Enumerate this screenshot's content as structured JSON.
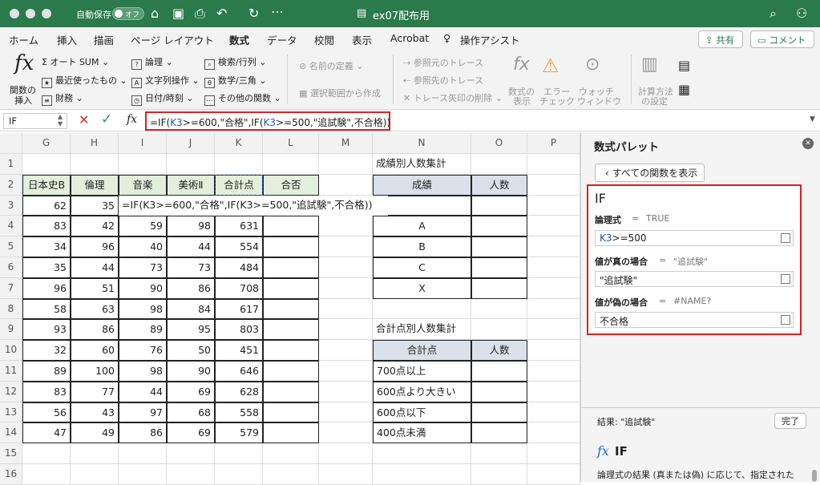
{
  "app": {
    "autosave_label": "自動保存",
    "autosave_state": "オフ",
    "title": "ex07配布用"
  },
  "ribbon_tabs": [
    "ホーム",
    "挿入",
    "描画",
    "ページ レイアウト",
    "数式",
    "データ",
    "校閲",
    "表示",
    "Acrobat",
    "操作アシスト"
  ],
  "active_tab": "数式",
  "share_label": "共有",
  "comment_label": "コメント",
  "ribbon": {
    "fx_label_1": "関数の",
    "fx_label_2": "挿入",
    "autosum": "オート SUM",
    "recent": "最近使ったもの",
    "financial": "財務",
    "logical": "論理",
    "text": "文字列操作",
    "datetime": "日付/時刻",
    "lookup": "検索/行列",
    "math": "数学/三角",
    "more": "その他の関数",
    "define_name": "名前の定義",
    "create_from_sel": "選択範囲から作成",
    "trace_precedents": "参照元のトレース",
    "trace_dependents": "参照先のトレース",
    "remove_arrows": "トレース矢印の削除",
    "show_formulas_1": "数式の",
    "show_formulas_2": "表示",
    "error_check_1": "エラー",
    "error_check_2": "チェック",
    "watch_1": "ウォッチ",
    "watch_2": "ウィンドウ",
    "calc_opt_1": "計算方法",
    "calc_opt_2": "の設定"
  },
  "formula_bar": {
    "name_box": "IF",
    "formula_pre": "=IF(",
    "ref1": "K3",
    "formula_mid": ">=600,\"合格\",IF(",
    "ref2": "K3",
    "formula_post": ">=500,\"追試験\",不合格))"
  },
  "columns": [
    "G",
    "H",
    "I",
    "J",
    "K",
    "L",
    "M",
    "N",
    "O",
    "P"
  ],
  "rows": [
    "1",
    "2",
    "3",
    "4",
    "5",
    "6",
    "7",
    "8",
    "9",
    "10",
    "11",
    "12",
    "13",
    "14",
    "15",
    "16"
  ],
  "main_table": {
    "headers": [
      "日本史B",
      "倫理",
      "音楽",
      "美術Ⅱ",
      "合計点",
      "合否"
    ],
    "rows": [
      [
        "62",
        "35",
        "",
        "",
        "",
        ""
      ],
      [
        "83",
        "42",
        "59",
        "98",
        "631",
        ""
      ],
      [
        "34",
        "96",
        "40",
        "44",
        "554",
        ""
      ],
      [
        "35",
        "44",
        "73",
        "73",
        "484",
        ""
      ],
      [
        "96",
        "51",
        "90",
        "86",
        "708",
        ""
      ],
      [
        "58",
        "63",
        "98",
        "84",
        "617",
        ""
      ],
      [
        "93",
        "86",
        "89",
        "95",
        "803",
        ""
      ],
      [
        "32",
        "60",
        "76",
        "50",
        "451",
        ""
      ],
      [
        "89",
        "100",
        "98",
        "90",
        "646",
        ""
      ],
      [
        "83",
        "77",
        "44",
        "69",
        "628",
        ""
      ],
      [
        "56",
        "43",
        "97",
        "68",
        "558",
        ""
      ],
      [
        "47",
        "49",
        "86",
        "69",
        "579",
        ""
      ]
    ],
    "editing_text": "=IF(K3>=600,\"合格\",IF(K3>=500,\"追試験\",不合格))"
  },
  "grade_table": {
    "title": "成績別人数集計",
    "headers": [
      "成績",
      "人数"
    ],
    "rows": [
      "",
      "A",
      "B",
      "C",
      "X"
    ]
  },
  "score_table": {
    "title": "合計点別人数集計",
    "headers": [
      "合計点",
      "人数"
    ],
    "rows": [
      "700点以上",
      "600点より大きい",
      "600点以下",
      "400点未満"
    ]
  },
  "palette": {
    "title": "数式パレット",
    "show_all": "すべての関数を表示",
    "func": "IF",
    "arg1_label": "論理式",
    "arg1_eq": "=",
    "arg1_result": "TRUE",
    "arg1_ref": "K3",
    "arg1_rest": ">=500",
    "arg2_label": "値が真の場合",
    "arg2_eq": "=",
    "arg2_result": "\"追試験\"",
    "arg2_value": "\"追試験\"",
    "arg3_label": "値が偽の場合",
    "arg3_eq": "=",
    "arg3_result": "#NAME?",
    "arg3_value": "不合格",
    "result_label": "結果: \"追試験\"",
    "done": "完了",
    "help_title": "IF",
    "help_text": "論理式の結果 (真または偽) に応じて、指定された"
  },
  "colors": {
    "accent": "#2a7a4b",
    "highlight_red": "#e01f1f",
    "ref_blue": "#1f56c7"
  }
}
